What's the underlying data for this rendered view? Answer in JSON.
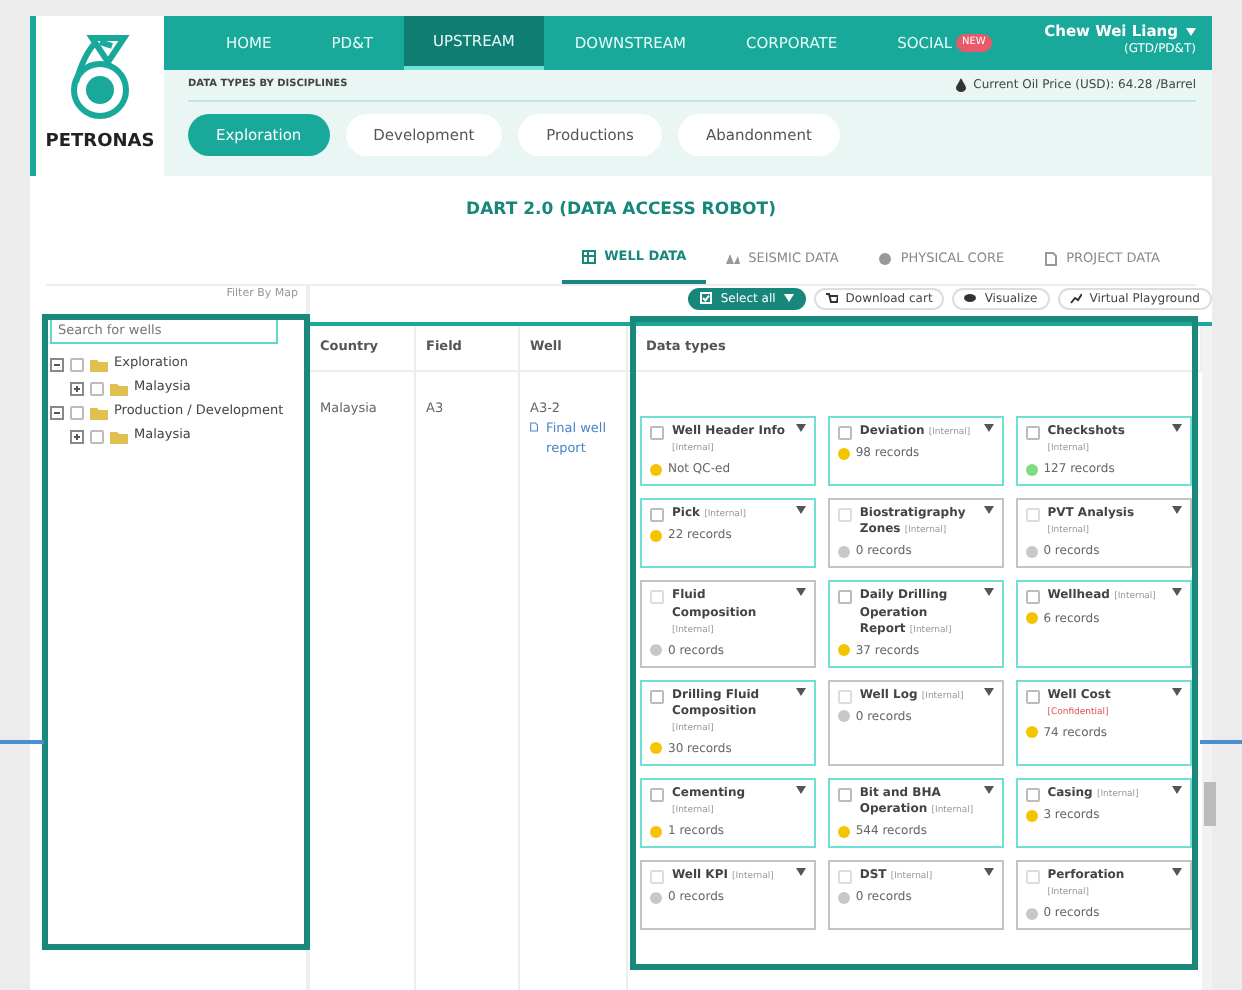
{
  "header": {
    "logo_text": "PETRONAS",
    "nav": [
      {
        "label": "HOME",
        "selected": false
      },
      {
        "label": "PD&T",
        "selected": false
      },
      {
        "label": "UPSTREAM",
        "selected": true
      },
      {
        "label": "DOWNSTREAM",
        "selected": false
      },
      {
        "label": "CORPORATE",
        "selected": false
      },
      {
        "label": "SOCIAL",
        "selected": false,
        "badge": "NEW"
      }
    ],
    "user": {
      "name": "Chew Wei Liang",
      "department": "(GTD/PD&T)"
    }
  },
  "subheader": {
    "label": "DATA TYPES BY DISCIPLINES",
    "oil_price": "Current Oil Price (USD): 64.28 /Barrel",
    "disciplines": [
      {
        "label": "Exploration",
        "selected": true
      },
      {
        "label": "Development",
        "selected": false
      },
      {
        "label": "Productions",
        "selected": false
      },
      {
        "label": "Abandonment",
        "selected": false
      }
    ]
  },
  "title": "DART 2.0 (DATA ACCESS ROBOT)",
  "data_tabs": [
    {
      "label": "WELL DATA",
      "selected": true,
      "kind": "table"
    },
    {
      "label": "SEISMIC DATA",
      "selected": false,
      "kind": "seismic"
    },
    {
      "label": "PHYSICAL CORE",
      "selected": false,
      "kind": "core"
    },
    {
      "label": "PROJECT DATA",
      "selected": false,
      "kind": "document"
    }
  ],
  "tree": {
    "filter_link": "Filter By Map",
    "search": {
      "placeholder": "Search for wells"
    },
    "nodes": [
      {
        "label": "Exploration",
        "expanded": true,
        "checked": false,
        "children": [
          {
            "label": "Malaysia",
            "expanded": false,
            "checked": false
          }
        ]
      },
      {
        "label": "Production / Development",
        "expanded": true,
        "checked": false,
        "children": [
          {
            "label": "Malaysia",
            "expanded": false,
            "checked": false
          }
        ]
      }
    ]
  },
  "toolbar": [
    {
      "label": "Select all",
      "kind": "select"
    },
    {
      "label": "Download cart",
      "kind": "cart"
    },
    {
      "label": "Visualize",
      "kind": "eye"
    },
    {
      "label": "Virtual Playground",
      "kind": "chart"
    }
  ],
  "table": {
    "columns": [
      "Country",
      "Field",
      "Well",
      "Data types"
    ],
    "row": {
      "country": "Malaysia",
      "field": "A3",
      "well": "A3-2",
      "report_link": "Final well report"
    }
  },
  "data_types": [
    {
      "name": "Well Header Info",
      "tag": "[Internal]",
      "confidential": false,
      "records": "Not QC-ed",
      "color": "#f5c400",
      "available": true
    },
    {
      "name": "Deviation",
      "tag": "[Internal]",
      "confidential": false,
      "records": "98 records",
      "color": "#f5c400",
      "available": true
    },
    {
      "name": "Checkshots",
      "tag": "[Internal]",
      "confidential": false,
      "records": "127 records",
      "color": "#7fdc7f",
      "available": true
    },
    {
      "name": "Pick",
      "tag": "[Internal]",
      "confidential": false,
      "records": "22 records",
      "color": "#f5c400",
      "available": true
    },
    {
      "name": "Biostratigraphy Zones",
      "tag": "[Internal]",
      "confidential": false,
      "records": "0 records",
      "color": "#c8c8c8",
      "available": false
    },
    {
      "name": "PVT Analysis",
      "tag": "[Internal]",
      "confidential": false,
      "records": "0 records",
      "color": "#c8c8c8",
      "available": false
    },
    {
      "name": "Fluid Composition",
      "tag": "[Internal]",
      "confidential": false,
      "records": "0 records",
      "color": "#c8c8c8",
      "available": false
    },
    {
      "name": "Daily Drilling Operation Report",
      "tag": "[Internal]",
      "confidential": false,
      "records": "37 records",
      "color": "#f5c400",
      "available": true
    },
    {
      "name": "Wellhead",
      "tag": "[Internal]",
      "confidential": false,
      "records": "6 records",
      "color": "#f5c400",
      "available": true
    },
    {
      "name": "Drilling Fluid Composition",
      "tag": "[Internal]",
      "confidential": false,
      "records": "30 records",
      "color": "#f5c400",
      "available": true
    },
    {
      "name": "Well Log",
      "tag": "[Internal]",
      "confidential": false,
      "records": "0 records",
      "color": "#c8c8c8",
      "available": false
    },
    {
      "name": "Well Cost",
      "tag": "[Confidential]",
      "confidential": true,
      "records": "74 records",
      "color": "#f5c400",
      "available": true
    },
    {
      "name": "Cementing",
      "tag": "[Internal]",
      "confidential": false,
      "records": "1 records",
      "color": "#f5c400",
      "available": true
    },
    {
      "name": "Bit and BHA Operation",
      "tag": "[Internal]",
      "confidential": false,
      "records": "544 records",
      "color": "#f5c400",
      "available": true
    },
    {
      "name": "Casing",
      "tag": "[Internal]",
      "confidential": false,
      "records": "3 records",
      "color": "#f5c400",
      "available": true
    },
    {
      "name": "Well KPI",
      "tag": "[Internal]",
      "confidential": false,
      "records": "0 records",
      "color": "#c8c8c8",
      "available": false
    },
    {
      "name": "DST",
      "tag": "[Internal]",
      "confidential": false,
      "records": "0 records",
      "color": "#c8c8c8",
      "available": false
    },
    {
      "name": "Perforation",
      "tag": "[Internal]",
      "confidential": false,
      "records": "0 records",
      "color": "#c8c8c8",
      "available": false
    }
  ]
}
